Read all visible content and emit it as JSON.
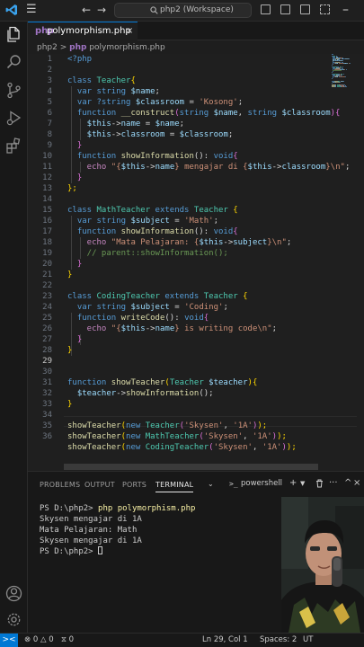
{
  "titlebar": {
    "search_text": "php2 (Workspace)",
    "menu_icon": "hamburger-menu-icon",
    "back_icon": "arrow-left-icon",
    "forward_icon": "arrow-right-icon"
  },
  "colors": {
    "accent": "#0078d4",
    "editor_bg": "#1f1f1f",
    "panel_bg": "#181818"
  },
  "tab": {
    "icon_text": "php",
    "label": "polymorphism.php",
    "close": "×"
  },
  "breadcrumb": {
    "folder": "php2",
    "separator": ">",
    "icon_text": "php",
    "file": "polymorphism.php"
  },
  "line_numbers": [
    "1",
    "2",
    "3",
    "4",
    "5",
    "6",
    "7",
    "8",
    "9",
    "10",
    "11",
    "12",
    "13",
    "14",
    "15",
    "16",
    "17",
    "18",
    "19",
    "20",
    "21",
    "22",
    "23",
    "24",
    "25",
    "26",
    "27",
    "28",
    "29",
    "30",
    "31",
    "32",
    "33",
    "34",
    "35",
    "36"
  ],
  "code": [
    [
      [
        "<?php",
        "k-tag"
      ]
    ],
    [],
    [
      [
        "class ",
        "k-kw"
      ],
      [
        "Teacher",
        "k-cls"
      ],
      [
        "{",
        "k-b1"
      ]
    ],
    [
      [
        "  var ",
        "k-kw"
      ],
      [
        "string ",
        "k-kw"
      ],
      [
        "$name",
        "k-var"
      ],
      [
        ";",
        "k-op"
      ]
    ],
    [
      [
        "  var ",
        "k-kw"
      ],
      [
        "?string ",
        "k-kw"
      ],
      [
        "$classroom",
        "k-var"
      ],
      [
        " = ",
        "k-op"
      ],
      [
        "'Kosong'",
        "k-str"
      ],
      [
        ";",
        "k-op"
      ]
    ],
    [
      [
        "  function ",
        "k-kw"
      ],
      [
        "__construct",
        "k-fn"
      ],
      [
        "(",
        "k-b2"
      ],
      [
        "string ",
        "k-kw"
      ],
      [
        "$name",
        "k-var"
      ],
      [
        ", ",
        "k-op"
      ],
      [
        "string ",
        "k-kw"
      ],
      [
        "$classroom",
        "k-var"
      ],
      [
        "){",
        "k-b2"
      ]
    ],
    [
      [
        "    $this",
        "k-var"
      ],
      [
        "->",
        "k-op"
      ],
      [
        "name",
        "k-var"
      ],
      [
        " = ",
        "k-op"
      ],
      [
        "$name",
        "k-var"
      ],
      [
        ";",
        "k-op"
      ]
    ],
    [
      [
        "    $this",
        "k-var"
      ],
      [
        "->",
        "k-op"
      ],
      [
        "classroom",
        "k-var"
      ],
      [
        " = ",
        "k-op"
      ],
      [
        "$classroom",
        "k-var"
      ],
      [
        ";",
        "k-op"
      ]
    ],
    [
      [
        "  }",
        "k-b2"
      ]
    ],
    [
      [
        "  function ",
        "k-kw"
      ],
      [
        "showInformation",
        "k-fn"
      ],
      [
        "(): ",
        "k-op"
      ],
      [
        "void",
        "k-kw"
      ],
      [
        "{",
        "k-b2"
      ]
    ],
    [
      [
        "    echo ",
        "k-ctrl"
      ],
      [
        "\"{",
        "k-str"
      ],
      [
        "$this",
        "k-var"
      ],
      [
        "->",
        "k-op"
      ],
      [
        "name",
        "k-var"
      ],
      [
        "} mengajar di {",
        "k-str"
      ],
      [
        "$this",
        "k-var"
      ],
      [
        "->",
        "k-op"
      ],
      [
        "classroom",
        "k-var"
      ],
      [
        "}\\n\"",
        "k-str"
      ],
      [
        ";",
        "k-op"
      ]
    ],
    [
      [
        "  }",
        "k-b2"
      ]
    ],
    [
      [
        "};",
        "k-b1"
      ]
    ],
    [],
    [
      [
        "class ",
        "k-kw"
      ],
      [
        "MathTeacher ",
        "k-cls"
      ],
      [
        "extends ",
        "k-kw"
      ],
      [
        "Teacher ",
        "k-cls"
      ],
      [
        "{",
        "k-b1"
      ]
    ],
    [
      [
        "  var ",
        "k-kw"
      ],
      [
        "string ",
        "k-kw"
      ],
      [
        "$subject",
        "k-var"
      ],
      [
        " = ",
        "k-op"
      ],
      [
        "'Math'",
        "k-str"
      ],
      [
        ";",
        "k-op"
      ]
    ],
    [
      [
        "  function ",
        "k-kw"
      ],
      [
        "showInformation",
        "k-fn"
      ],
      [
        "(): ",
        "k-op"
      ],
      [
        "void",
        "k-kw"
      ],
      [
        "{",
        "k-b2"
      ]
    ],
    [
      [
        "    echo ",
        "k-ctrl"
      ],
      [
        "\"Mata Pelajaran: {",
        "k-str"
      ],
      [
        "$this",
        "k-var"
      ],
      [
        "->",
        "k-op"
      ],
      [
        "subject",
        "k-var"
      ],
      [
        "}\\n\"",
        "k-str"
      ],
      [
        ";",
        "k-op"
      ]
    ],
    [
      [
        "    // parent::showInformation();",
        "k-com"
      ]
    ],
    [
      [
        "  }",
        "k-b2"
      ]
    ],
    [
      [
        "}",
        "k-b1"
      ]
    ],
    [],
    [
      [
        "class ",
        "k-kw"
      ],
      [
        "CodingTeacher ",
        "k-cls"
      ],
      [
        "extends ",
        "k-kw"
      ],
      [
        "Teacher ",
        "k-cls"
      ],
      [
        "{",
        "k-b1"
      ]
    ],
    [
      [
        "  var ",
        "k-kw"
      ],
      [
        "string ",
        "k-kw"
      ],
      [
        "$subject",
        "k-var"
      ],
      [
        " = ",
        "k-op"
      ],
      [
        "'Coding'",
        "k-str"
      ],
      [
        ";",
        "k-op"
      ]
    ],
    [
      [
        "  function ",
        "k-kw"
      ],
      [
        "writeCode",
        "k-fn"
      ],
      [
        "(): ",
        "k-op"
      ],
      [
        "void",
        "k-kw"
      ],
      [
        "{",
        "k-b2"
      ]
    ],
    [
      [
        "    echo ",
        "k-ctrl"
      ],
      [
        "\"{",
        "k-str"
      ],
      [
        "$this",
        "k-var"
      ],
      [
        "->",
        "k-op"
      ],
      [
        "name",
        "k-var"
      ],
      [
        "} is writing code\\n\"",
        "k-str"
      ],
      [
        ";",
        "k-op"
      ]
    ],
    [
      [
        "  }",
        "k-b2"
      ]
    ],
    [
      [
        "}",
        "k-b1"
      ]
    ],
    [],
    [],
    [
      [
        "function ",
        "k-kw"
      ],
      [
        "showTeacher",
        "k-fn"
      ],
      [
        "(",
        "k-b1"
      ],
      [
        "Teacher ",
        "k-cls"
      ],
      [
        "$teacher",
        "k-var"
      ],
      [
        "){",
        "k-b1"
      ]
    ],
    [
      [
        "  $teacher",
        "k-var"
      ],
      [
        "->",
        "k-op"
      ],
      [
        "showInformation",
        "k-fn"
      ],
      [
        "();",
        "k-op"
      ]
    ],
    [
      [
        "}",
        "k-b1"
      ]
    ],
    [],
    [
      [
        "showTeacher",
        "k-fn"
      ],
      [
        "(",
        "k-b1"
      ],
      [
        "new ",
        "k-kw"
      ],
      [
        "Teacher",
        "k-cls"
      ],
      [
        "(",
        "k-b2"
      ],
      [
        "'Skysen'",
        "k-str"
      ],
      [
        ", ",
        "k-op"
      ],
      [
        "'1A'",
        "k-str"
      ],
      [
        ")",
        "k-b2"
      ],
      [
        ");",
        "k-b1"
      ]
    ],
    [
      [
        "showTeacher",
        "k-fn"
      ],
      [
        "(",
        "k-b1"
      ],
      [
        "new ",
        "k-kw"
      ],
      [
        "MathTeacher",
        "k-cls"
      ],
      [
        "(",
        "k-b2"
      ],
      [
        "'Skysen'",
        "k-str"
      ],
      [
        ", ",
        "k-op"
      ],
      [
        "'1A'",
        "k-str"
      ],
      [
        ")",
        "k-b2"
      ],
      [
        ");",
        "k-b1"
      ]
    ],
    [
      [
        "showTeacher",
        "k-fn"
      ],
      [
        "(",
        "k-b1"
      ],
      [
        "new ",
        "k-kw"
      ],
      [
        "CodingTeacher",
        "k-cls"
      ],
      [
        "(",
        "k-b2"
      ],
      [
        "'Skysen'",
        "k-str"
      ],
      [
        ", ",
        "k-op"
      ],
      [
        "'1A'",
        "k-str"
      ],
      [
        ")",
        "k-b2"
      ],
      [
        ");",
        "k-b1"
      ]
    ]
  ],
  "panel": {
    "tabs": [
      "PROBLEMS",
      "OUTPUT",
      "PORTS",
      "TERMINAL"
    ],
    "active_tab": "TERMINAL",
    "terminal_name": "powershell",
    "terminal_icon": ">_",
    "add": "+",
    "more": "···",
    "maximize": "^",
    "close": "×"
  },
  "terminal": [
    {
      "prompt": "PS D:\\php2> ",
      "cmd": "php polymorphism.php"
    },
    {
      "text": "Skysen mengajar di 1A"
    },
    {
      "text": "Mata Pelajaran: Math"
    },
    {
      "text": "Skysen mengajar di 1A"
    },
    {
      "prompt": "PS D:\\php2> ",
      "cursor": true
    }
  ],
  "statusbar": {
    "remote": "><",
    "errors": "0",
    "warnings": "0",
    "ports": "0",
    "position": "Ln 29, Col 1",
    "spaces": "Spaces: 2",
    "encoding": "UT"
  }
}
